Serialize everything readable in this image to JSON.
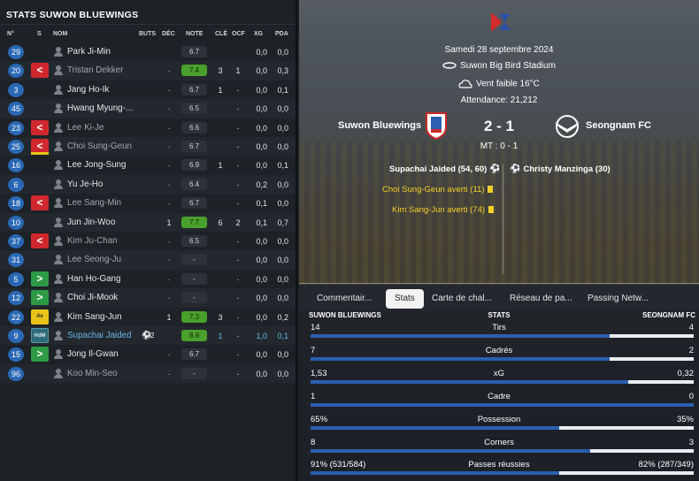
{
  "left": {
    "title": "STATS SUWON BLUEWINGS",
    "headers": {
      "num": "N°",
      "s": "S",
      "nom": "NOM",
      "buts": "BUTS",
      "dec": "DÉC",
      "note": "NOTE",
      "cle": "CLÉ",
      "ocf": "OCF",
      "xg": "XG",
      "pda": "PDA"
    },
    "players": [
      {
        "num": "29",
        "sub": "",
        "name": "Park Ji-Min",
        "buts": "",
        "dec": "",
        "note": "6.7",
        "note_green": false,
        "cle": "",
        "ocf": "",
        "xg": "0,0",
        "pda": "0,0",
        "dim": false
      },
      {
        "num": "20",
        "sub": "out",
        "name": "Tristan Dekker",
        "buts": "",
        "dec": "-",
        "note": "7.4",
        "note_green": true,
        "cle": "3",
        "ocf": "1",
        "xg": "0,0",
        "pda": "0,3",
        "dim": true
      },
      {
        "num": "3",
        "sub": "",
        "name": "Jang Ho-Ik",
        "buts": "",
        "dec": "-",
        "note": "6.7",
        "note_green": false,
        "cle": "1",
        "ocf": "-",
        "xg": "0,0",
        "pda": "0,1",
        "dim": false
      },
      {
        "num": "45",
        "sub": "",
        "name": "Hwang Myung-...",
        "buts": "",
        "dec": "-",
        "note": "6.5",
        "note_green": false,
        "cle": "",
        "ocf": "-",
        "xg": "0,0",
        "pda": "0,0",
        "dim": false
      },
      {
        "num": "23",
        "sub": "out",
        "name": "Lee Ki-Je",
        "buts": "",
        "dec": "-",
        "note": "6.6",
        "note_green": false,
        "cle": "",
        "ocf": "-",
        "xg": "0,0",
        "pda": "0,0",
        "dim": true
      },
      {
        "num": "25",
        "sub": "out-av",
        "name": "Choi Sung-Geun",
        "buts": "",
        "dec": "-",
        "note": "6.7",
        "note_green": false,
        "cle": "",
        "ocf": "-",
        "xg": "0,0",
        "pda": "0,0",
        "dim": true
      },
      {
        "num": "16",
        "sub": "",
        "name": "Lee Jong-Sung",
        "buts": "",
        "dec": "-",
        "note": "6.9",
        "note_green": false,
        "cle": "1",
        "ocf": "-",
        "xg": "0,0",
        "pda": "0,1",
        "dim": false
      },
      {
        "num": "6",
        "sub": "",
        "name": "Yu Je-Ho",
        "buts": "",
        "dec": "-",
        "note": "6.4",
        "note_green": false,
        "cle": "",
        "ocf": "-",
        "xg": "0,2",
        "pda": "0,0",
        "dim": false
      },
      {
        "num": "18",
        "sub": "out",
        "name": "Lee Sang-Min",
        "buts": "",
        "dec": "-",
        "note": "6.7",
        "note_green": false,
        "cle": "",
        "ocf": "-",
        "xg": "0,1",
        "pda": "0,0",
        "dim": true
      },
      {
        "num": "10",
        "sub": "",
        "name": "Jun Jin-Woo",
        "buts": "1",
        "dec": "",
        "note": "7.7",
        "note_green": true,
        "cle": "6",
        "ocf": "2",
        "xg": "0,1",
        "pda": "0,7",
        "dim": false
      },
      {
        "num": "37",
        "sub": "out",
        "name": "Kim Ju-Chan",
        "buts": "",
        "dec": "-",
        "note": "6.5",
        "note_green": false,
        "cle": "",
        "ocf": "-",
        "xg": "0,0",
        "pda": "0,0",
        "dim": true
      },
      {
        "num": "31",
        "sub": "",
        "name": "Lee Seong-Ju",
        "buts": "",
        "dec": "-",
        "note": "-",
        "note_green": false,
        "cle": "",
        "ocf": "-",
        "xg": "0,0",
        "pda": "0,0",
        "dim": true
      },
      {
        "num": "5",
        "sub": "in",
        "name": "Han Ho-Gang",
        "buts": "",
        "dec": "-",
        "note": "-",
        "note_green": false,
        "cle": "",
        "ocf": "-",
        "xg": "0,0",
        "pda": "0,0",
        "dim": false
      },
      {
        "num": "12",
        "sub": "in",
        "name": "Choi Ji-Mook",
        "buts": "",
        "dec": "-",
        "note": "-",
        "note_green": false,
        "cle": "",
        "ocf": "-",
        "xg": "0,0",
        "pda": "0,0",
        "dim": false
      },
      {
        "num": "22",
        "sub": "av",
        "name": "Kim Sang-Jun",
        "buts": "1",
        "dec": "",
        "note": "7.3",
        "note_green": true,
        "cle": "3",
        "ocf": "-",
        "xg": "0,0",
        "pda": "0,2",
        "dim": false
      },
      {
        "num": "9",
        "sub": "hdm",
        "name": "Supachai Jaided",
        "buts": "",
        "dec": "",
        "note": "8.9",
        "note_green": true,
        "cle": "1",
        "ocf": "-",
        "xg": "1,0",
        "pda": "0,1",
        "dim": false,
        "highlight": true,
        "goals_badge": "2"
      },
      {
        "num": "15",
        "sub": "in",
        "name": "Jong Il-Gwan",
        "buts": "",
        "dec": "-",
        "note": "6.7",
        "note_green": false,
        "cle": "",
        "ocf": "-",
        "xg": "0,0",
        "pda": "0,0",
        "dim": false
      },
      {
        "num": "96",
        "sub": "",
        "name": "Koo Min-Seo",
        "buts": "",
        "dec": "-",
        "note": "-",
        "note_green": false,
        "cle": "",
        "ocf": "-",
        "xg": "0,0",
        "pda": "0,0",
        "dim": true
      }
    ],
    "sub_labels": {
      "in": ">",
      "out": "<",
      "av": "Av",
      "hdm": "HdM"
    }
  },
  "match": {
    "date": "Samedi 28 septembre 2024",
    "stadium": "Suwon Big Bird Stadium",
    "weather": "Vent faible 16°C",
    "attendance": "Attendance: 21,212",
    "home": "Suwon Bluewings",
    "away": "Seongnam FC",
    "score": "2 - 1",
    "halftime": "MT : 0 - 1",
    "events": {
      "home_scorer": "Supachai Jaided (54, 60)",
      "away_scorer": "Christy Manzinga (30)",
      "card1": "Choi Sung-Geun averti (11)",
      "card2": "Kim Sang-Jun averti (74)"
    },
    "colors": {
      "home_blue": "#2b5fb0",
      "card_yellow": "#f2cf2a",
      "note_green": "#4aa02c"
    }
  },
  "tabs": [
    "Commentair...",
    "Stats",
    "Carte de chal...",
    "Réseau de pa...",
    "Passing Netw..."
  ],
  "active_tab": "Stats",
  "stats": {
    "home_label": "SUWON BLUEWINGS",
    "center_label": "STATS",
    "away_label": "SEONGNAM FC",
    "rows": [
      {
        "name": "Tirs",
        "home": "14",
        "away": "4",
        "home_share": 0.78
      },
      {
        "name": "Cadrés",
        "home": "7",
        "away": "2",
        "home_share": 0.78
      },
      {
        "name": "xG",
        "home": "1,53",
        "away": "0,32",
        "home_share": 0.83
      },
      {
        "name": "Cadre",
        "home": "1",
        "away": "0",
        "home_share": 1.0
      },
      {
        "name": "Possession",
        "home": "65%",
        "away": "35%",
        "home_share": 0.65
      },
      {
        "name": "Corners",
        "home": "8",
        "away": "3",
        "home_share": 0.73
      },
      {
        "name": "Passes réussies",
        "home": "91% (531/584)",
        "away": "82% (287/349)",
        "home_share": 0.65
      }
    ]
  }
}
